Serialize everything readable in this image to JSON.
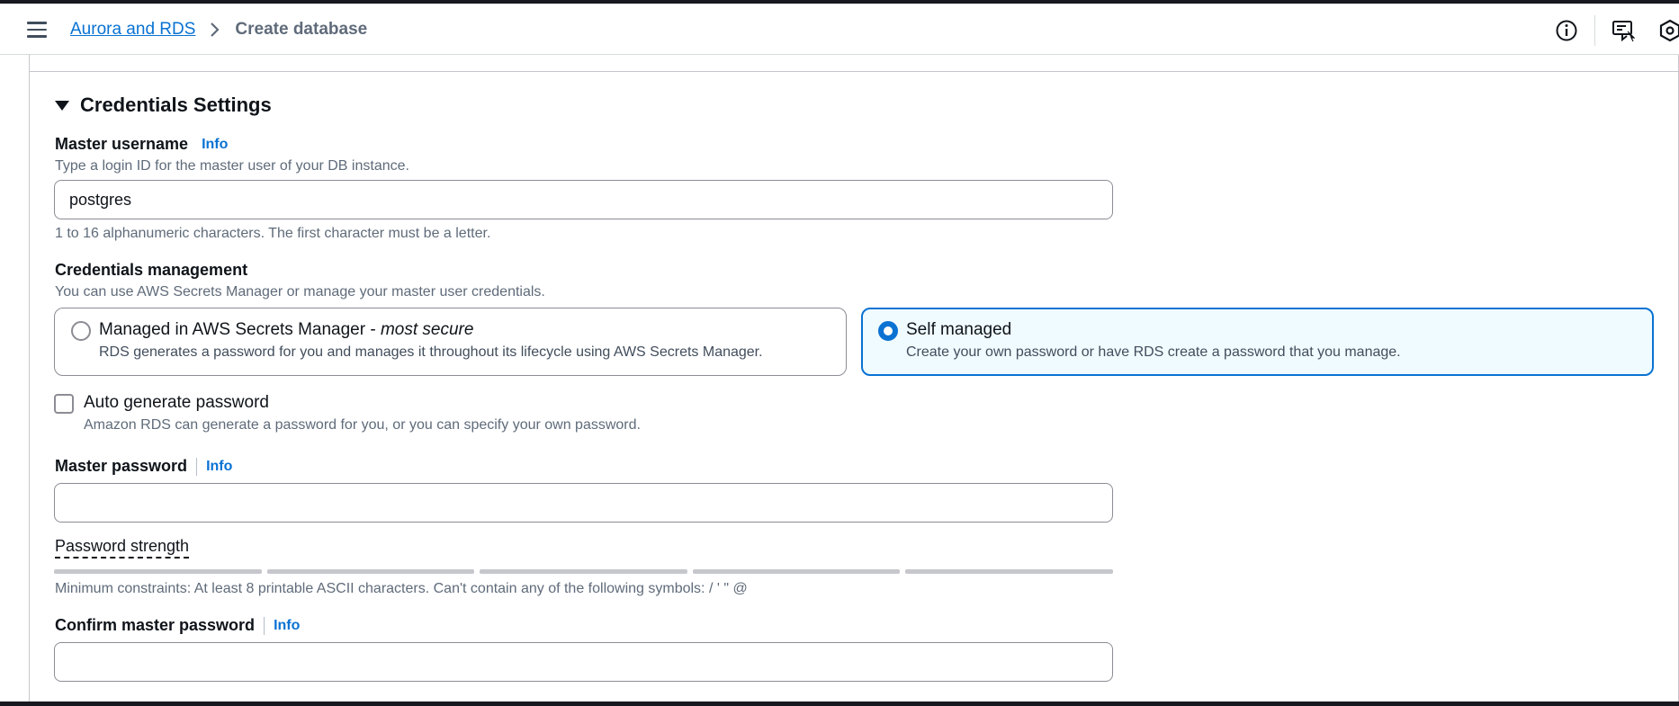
{
  "breadcrumb": {
    "parent": "Aurora and RDS",
    "current": "Create database"
  },
  "header_icons": [
    "info-circle-icon",
    "feedback-icon",
    "settings-hexagon-icon"
  ],
  "section": {
    "title": "Credentials Settings"
  },
  "master_username": {
    "label": "Master username",
    "info": "Info",
    "description": "Type a login ID for the master user of your DB instance.",
    "value": "postgres",
    "constraint": "1 to 16 alphanumeric characters. The first character must be a letter."
  },
  "credentials_management": {
    "label": "Credentials management",
    "description": "You can use AWS Secrets Manager or manage your master user credentials.",
    "options": [
      {
        "title": "Managed in AWS Secrets Manager - ",
        "title_emphasis": "most secure",
        "description": "RDS generates a password for you and manages it throughout its lifecycle using AWS Secrets Manager.",
        "selected": false
      },
      {
        "title": "Self managed",
        "title_emphasis": "",
        "description": "Create your own password or have RDS create a password that you manage.",
        "selected": true
      }
    ]
  },
  "auto_generate": {
    "label": "Auto generate password",
    "description": "Amazon RDS can generate a password for you, or you can specify your own password.",
    "checked": false
  },
  "master_password": {
    "label": "Master password",
    "info": "Info",
    "value": "",
    "strength_label": "Password strength",
    "constraint": "Minimum constraints: At least 8 printable ASCII characters. Can't contain any of the following symbols: / ' \" @"
  },
  "confirm_password": {
    "label": "Confirm master password",
    "info": "Info",
    "value": ""
  }
}
